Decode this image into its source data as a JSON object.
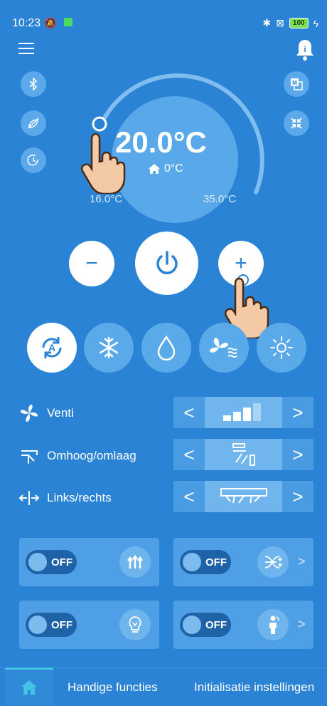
{
  "status_bar": {
    "time": "10:23",
    "battery": "100"
  },
  "thermostat": {
    "set_temp": "20.0°C",
    "outdoor_temp": "0°C",
    "range_min": "16.0°C",
    "range_max": "35.0°C"
  },
  "controls": {
    "minus": "−",
    "plus": "+"
  },
  "settings": {
    "fan": {
      "label": "Venti",
      "prev": "<",
      "next": ">"
    },
    "vertical": {
      "label": "Omhoog/omlaag",
      "prev": "<",
      "next": ">"
    },
    "horizontal": {
      "label": "Links/rechts",
      "prev": "<",
      "next": ">"
    }
  },
  "feature_cards": [
    {
      "state": "OFF",
      "icon": "airflow-up-icon",
      "chevron": ""
    },
    {
      "state": "OFF",
      "icon": "air-purify-icon",
      "chevron": ">"
    },
    {
      "state": "OFF",
      "icon": "bulb-icon",
      "chevron": ""
    },
    {
      "state": "OFF",
      "icon": "person-sense-icon",
      "chevron": ">"
    }
  ],
  "nav": {
    "handy_functions": "Handige functies",
    "init_settings": "Initialisatie instellingen"
  },
  "colors": {
    "background": "#2a83d4",
    "active_tab": "#45c3e6",
    "battery": "#7de05a"
  }
}
